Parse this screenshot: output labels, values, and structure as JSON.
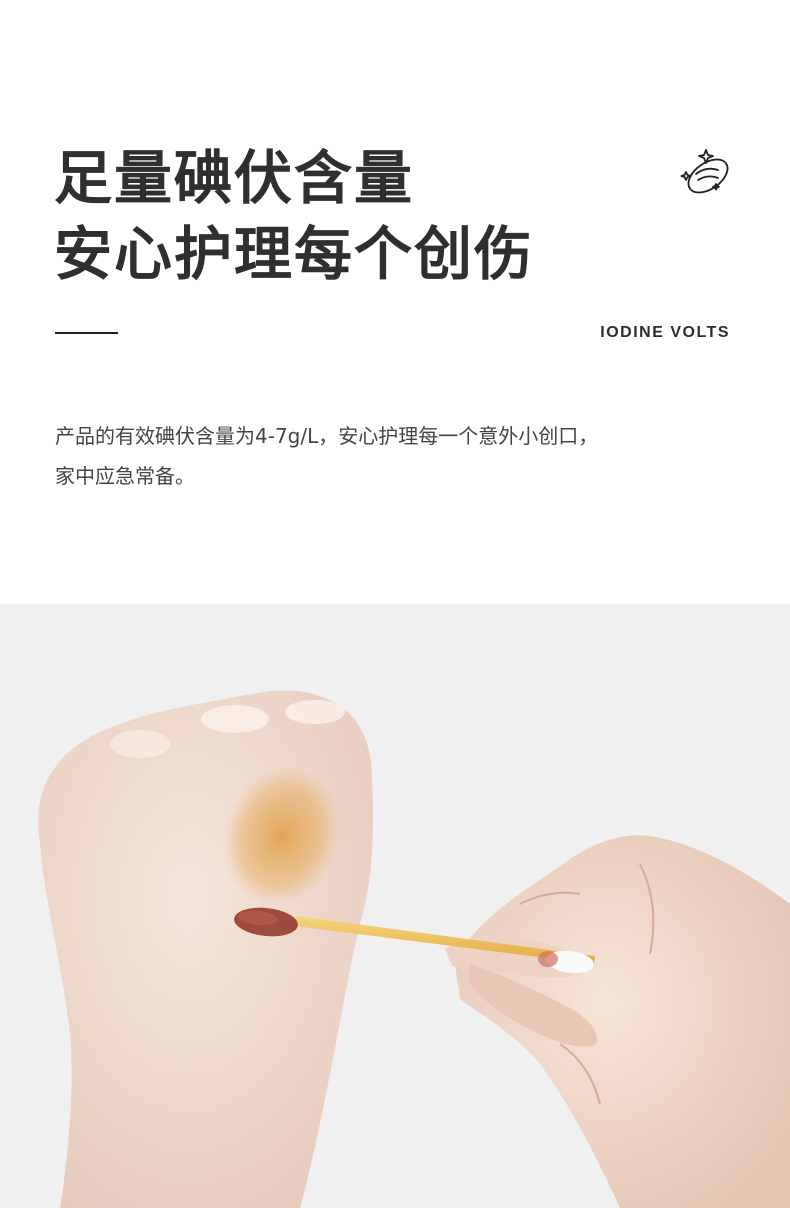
{
  "headline": {
    "line1": "足量碘伏含量",
    "line2": "安心护理每个创伤"
  },
  "brand": "IODINE VOLTS",
  "description": {
    "line1": "产品的有效碘伏含量为4-7g/L，安心护理每一个意外小创口，",
    "line2": "家中应急常备。"
  },
  "icons": {
    "badge": "sparkle-planet-icon"
  },
  "colors": {
    "text_dark": "#2f2f2f",
    "photo_background": "#f0f0f1",
    "iodine_stain": "#e0a04a",
    "swab_tip": "#9e4a3e",
    "stick": "#f3c65a"
  }
}
